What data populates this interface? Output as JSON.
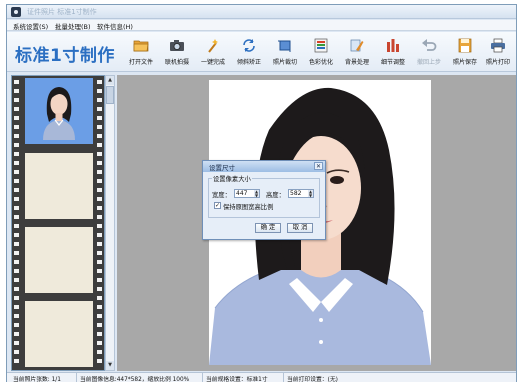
{
  "window": {
    "title": "证件照片 标准1寸制作"
  },
  "menu": [
    "系统设置(S)",
    "批量处理(B)",
    "软件信息(H)"
  ],
  "toolbar": {
    "heading": "标准1寸制作",
    "tools": [
      {
        "label": "打开文件",
        "icon": "folder-open-icon"
      },
      {
        "label": "联机拍摄",
        "icon": "camera-icon"
      },
      {
        "label": "一键完成",
        "icon": "magic-wand-icon"
      },
      {
        "label": "倾斜矫正",
        "icon": "rotate-correct-icon"
      },
      {
        "label": "照片裁切",
        "icon": "crop-icon"
      },
      {
        "label": "色彩优化",
        "icon": "palette-icon"
      },
      {
        "label": "背景处理",
        "icon": "background-brush-icon"
      },
      {
        "label": "细节调整",
        "icon": "adjust-icon"
      },
      {
        "label": "撤回上步",
        "icon": "undo-icon",
        "disabled": true
      },
      {
        "label": "照片保存",
        "icon": "save-icon"
      },
      {
        "label": "照片打印",
        "icon": "printer-icon"
      }
    ]
  },
  "dialog": {
    "title": "设置尺寸",
    "close": "✕",
    "group_label": "设置像素大小",
    "width_label": "宽度：",
    "width_value": "447",
    "height_label": "高度：",
    "height_value": "582",
    "keep_ratio_label": "保持原图宽高比例",
    "keep_ratio_checked": true,
    "check_mark": "✓",
    "ok": "确 定",
    "cancel": "取 消"
  },
  "status": {
    "count": "当前照片张数: 1/1",
    "info": "当前图像信息:447*582，缩放比例 100%",
    "spec": "当前规格设置：标准1寸",
    "print": "当前打印设置：(无)"
  },
  "colors": {
    "accent": "#2b6fc2",
    "photo_background": "#6b9ee6",
    "film": "#3d3d3d",
    "workspace": "#a8a8a8"
  }
}
